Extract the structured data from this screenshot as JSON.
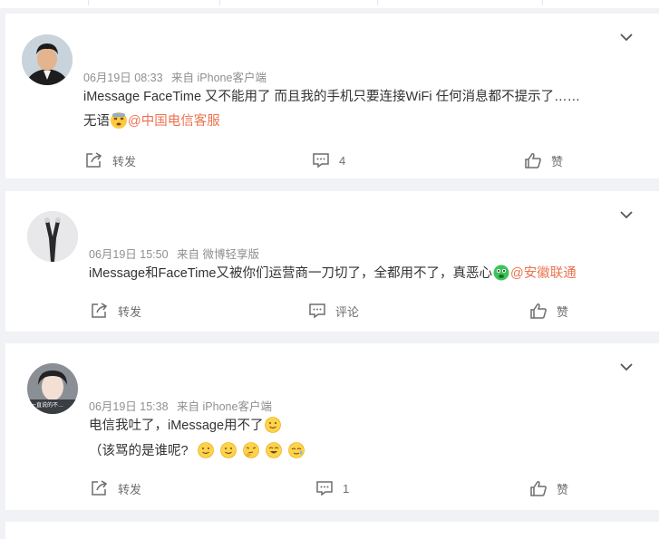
{
  "comments": [
    {
      "meta_date": "06月19日 08:33",
      "meta_source": "来自 iPhone客户端",
      "line1": "iMessage FaceTime 又不能用了 而且我的手机只要连接WiFi 任何消息都不提示了……",
      "line2_prefix": "无语",
      "line2_mention": "@中国电信客服",
      "actions": {
        "repost": "转发",
        "comment": "4",
        "like": "赞"
      }
    },
    {
      "meta_date": "06月19日 15:50",
      "meta_source": "来自 微博轻享版",
      "line1": "iMessage和FaceTime又被你们运营商一刀切了，全都用不了，真恶心",
      "line1_mention": "@安徽联通",
      "actions": {
        "repost": "转发",
        "comment": "评论",
        "like": "赞"
      }
    },
    {
      "meta_date": "06月19日 15:38",
      "meta_source": "来自 iPhone客户端",
      "line1": "电信我吐了，iMessage用不了",
      "line2": "（该骂的是谁呢?",
      "avatar_caption": "一直说的不…",
      "actions": {
        "repost": "转发",
        "comment": "1",
        "like": "赞"
      }
    }
  ],
  "icons": {
    "chevron": "chevron-down-icon",
    "repost": "share-icon",
    "comment": "comment-icon",
    "like": "thumbs-up-icon",
    "emoji_faint": "dizzy-face-emoji",
    "emoji_vomit": "vomit-face-emoji",
    "emoji_smile": "smile-emoji",
    "emoji_think": "thinking-emoji",
    "emoji_grin": "grin-emoji",
    "emoji_sweat": "sweat-emoji"
  },
  "colors": {
    "accent": "#eb7350",
    "background": "#f1f2f5",
    "text": "#333333",
    "meta": "#8f8f8f"
  }
}
